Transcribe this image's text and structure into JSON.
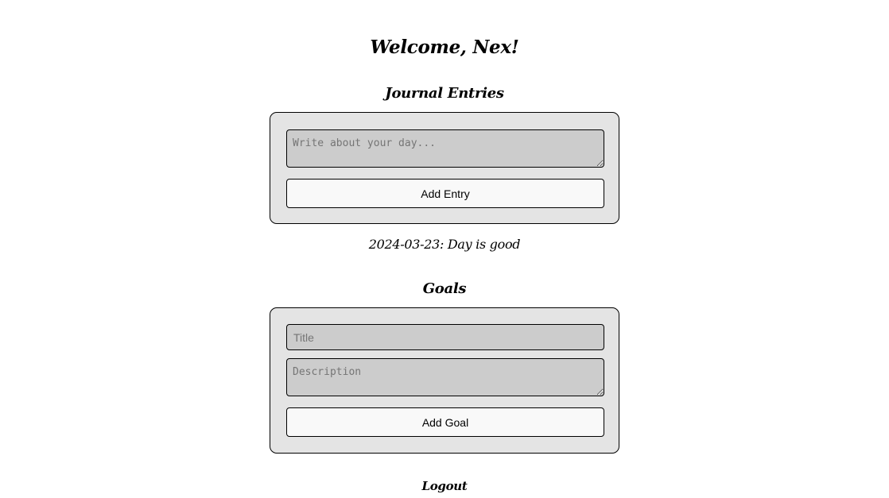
{
  "header": {
    "welcome": "Welcome, Nex!"
  },
  "journal": {
    "heading": "Journal Entries",
    "entry_placeholder": "Write about your day...",
    "add_button": "Add Entry",
    "entries": [
      "2024-03-23: Day is good"
    ]
  },
  "goals": {
    "heading": "Goals",
    "title_placeholder": "Title",
    "description_placeholder": "Description",
    "add_button": "Add Goal"
  },
  "footer": {
    "logout": "Logout"
  },
  "colors": {
    "card_background": "#e4e4e4",
    "input_background": "#cccccc",
    "button_background": "#f9f9f9",
    "border": "#000000"
  }
}
